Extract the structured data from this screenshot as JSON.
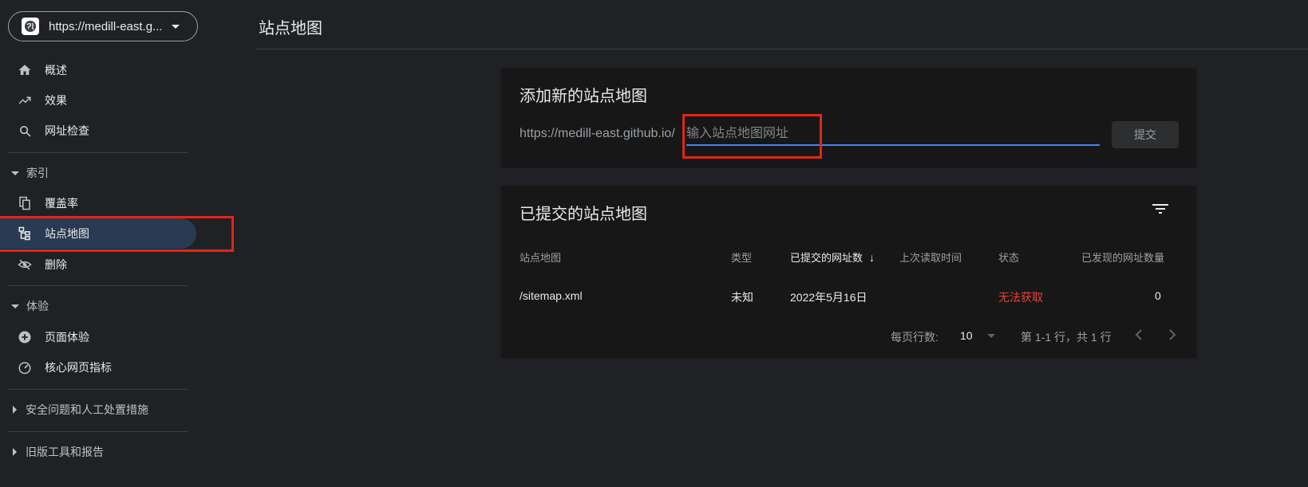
{
  "property": {
    "url": "https://medill-east.g..."
  },
  "nav": {
    "overview": "概述",
    "performance": "效果",
    "url_inspection": "网址检查",
    "index_section": "索引",
    "coverage": "覆盖率",
    "sitemaps": "站点地图",
    "removals": "删除",
    "experience_section": "体验",
    "page_experience": "页面体验",
    "core_web_vitals": "核心网页指标",
    "security_section": "安全问题和人工处置措施",
    "legacy_section": "旧版工具和报告"
  },
  "page": {
    "title": "站点地图"
  },
  "add_card": {
    "title": "添加新的站点地图",
    "prefix": "https://medill-east.github.io/",
    "input_placeholder": "输入站点地图网址",
    "input_value": "",
    "submit_label": "提交"
  },
  "submitted_card": {
    "title": "已提交的站点地图",
    "columns": [
      "站点地图",
      "类型",
      "已提交的网址数",
      "上次读取时间",
      "状态",
      "已发现的网址数量"
    ],
    "sort_indicator": "↓",
    "rows": [
      {
        "sitemap": "/sitemap.xml",
        "type": "未知",
        "submitted": "2022年5月16日",
        "last_read": "",
        "status": "无法获取",
        "discovered": "0"
      }
    ],
    "rows_per_page_label": "每页行数:",
    "rows_per_page_value": "10",
    "pagination_text": "第 1-1 行，共 1 行"
  },
  "colors": {
    "accent": "#4285f4",
    "error": "#ea4335",
    "highlight": "#e0261b",
    "active_nav": "#2a3a52"
  }
}
